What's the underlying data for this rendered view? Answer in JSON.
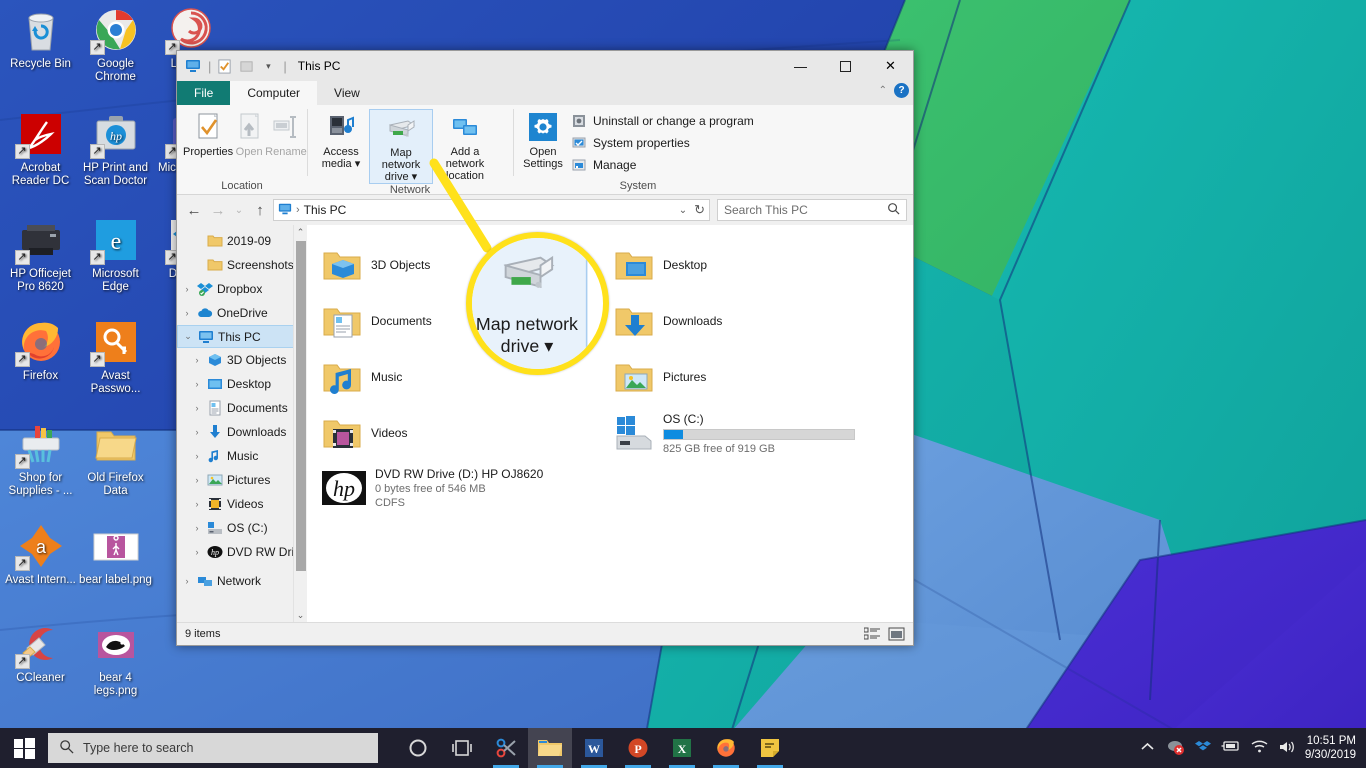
{
  "desktop": {
    "icons": [
      {
        "label": "Recycle Bin",
        "icon": "recycle-bin-icon",
        "shortcut": false
      },
      {
        "label": "Google Chrome",
        "icon": "chrome-icon",
        "shortcut": true
      },
      {
        "label": "Lollipop",
        "icon": "lollipop-icon",
        "shortcut": true
      },
      {
        "label": "Acrobat Reader DC",
        "icon": "acrobat-icon",
        "shortcut": true
      },
      {
        "label": "HP Print and Scan Doctor",
        "icon": "hp-briefcase-icon",
        "shortcut": true
      },
      {
        "label": "Microsoft T...",
        "icon": "teams-icon",
        "shortcut": true
      },
      {
        "label": "HP Officejet Pro 8620",
        "icon": "printer-icon",
        "shortcut": true
      },
      {
        "label": "Microsoft Edge",
        "icon": "edge-icon",
        "shortcut": true
      },
      {
        "label": "Dropbox",
        "icon": "dropbox-icon",
        "shortcut": true
      },
      {
        "label": "Firefox",
        "icon": "firefox-icon",
        "shortcut": true
      },
      {
        "label": "Avast Passwo...",
        "icon": "avast-password-key-icon",
        "shortcut": true
      },
      {
        "label": "Shop for Supplies - ...",
        "icon": "printer-supplies-icon",
        "shortcut": true
      },
      {
        "label": "Old Firefox Data",
        "icon": "folder-icon",
        "shortcut": false
      },
      {
        "label": "Avast Intern...",
        "icon": "avast-icon",
        "shortcut": true
      },
      {
        "label": "bear label.png",
        "icon": "image-thumbnail-icon",
        "shortcut": false
      },
      {
        "label": "CCleaner",
        "icon": "ccleaner-icon",
        "shortcut": true
      },
      {
        "label": "bear 4 legs.png",
        "icon": "image-thumbnail-icon",
        "shortcut": false
      }
    ]
  },
  "window": {
    "title": "This PC",
    "quick_access": [
      "monitor-icon",
      "properties-icon",
      "new-folder-icon",
      "customize-dropdown-icon"
    ],
    "controls": {
      "minimize": "—",
      "maximize": "☐",
      "close": "✕"
    },
    "help_label": "?",
    "collapse_ribbon_label": "⌃"
  },
  "tabs": [
    {
      "label": "File",
      "kind": "file"
    },
    {
      "label": "Computer",
      "kind": "active"
    },
    {
      "label": "View",
      "kind": "normal"
    }
  ],
  "ribbon": {
    "groups": [
      {
        "title": "Location",
        "buttons": [
          {
            "label": "Properties",
            "icon": "properties-icon",
            "disabled": false
          },
          {
            "label": "Open",
            "icon": "open-icon",
            "disabled": true
          },
          {
            "label": "Rename",
            "icon": "rename-icon",
            "disabled": true
          }
        ]
      },
      {
        "title": "Network",
        "buttons": [
          {
            "label": "Access media ▾",
            "icon": "access-media-icon",
            "disabled": false
          },
          {
            "label": "Map network drive ▾",
            "icon": "map-network-drive-icon",
            "disabled": false,
            "highlighted": true
          },
          {
            "label": "Add a network location",
            "icon": "add-network-location-icon",
            "disabled": false
          }
        ]
      },
      {
        "title": "System",
        "big_button": {
          "label": "Open Settings",
          "icon": "gear-icon"
        },
        "small_items": [
          {
            "label": "Uninstall or change a program",
            "icon": "uninstall-program-icon"
          },
          {
            "label": "System properties",
            "icon": "system-properties-icon"
          },
          {
            "label": "Manage",
            "icon": "manage-icon"
          }
        ]
      }
    ]
  },
  "address_bar": {
    "back_label": "←",
    "forward_label": "→",
    "recent_label": "⌄",
    "up_label": "↑",
    "path_icon": "this-pc-icon",
    "path_crumb": "This PC",
    "path_separator": "›",
    "dropdown_label": "⌄",
    "refresh_label": "↻",
    "search_placeholder": "Search This PC",
    "search_value": "",
    "search_icon": "magnifier-icon"
  },
  "nav_pane": {
    "items": [
      {
        "label": "2019-09",
        "icon": "folder-icon",
        "expander": "",
        "indent": 1,
        "selected": false
      },
      {
        "label": "Screenshots",
        "icon": "folder-icon",
        "expander": "",
        "indent": 1,
        "selected": false
      },
      {
        "label": "Dropbox",
        "icon": "dropbox-icon",
        "expander": "›",
        "indent": 0,
        "selected": false
      },
      {
        "label": "OneDrive",
        "icon": "onedrive-icon",
        "expander": "›",
        "indent": 0,
        "selected": false
      },
      {
        "label": "This PC",
        "icon": "this-pc-icon",
        "expander": "⌄",
        "indent": 0,
        "selected": true
      },
      {
        "label": "3D Objects",
        "icon": "3d-objects-icon",
        "expander": "›",
        "indent": 1,
        "selected": false
      },
      {
        "label": "Desktop",
        "icon": "desktop-icon",
        "expander": "›",
        "indent": 1,
        "selected": false
      },
      {
        "label": "Documents",
        "icon": "documents-icon",
        "expander": "›",
        "indent": 1,
        "selected": false
      },
      {
        "label": "Downloads",
        "icon": "downloads-icon",
        "expander": "›",
        "indent": 1,
        "selected": false
      },
      {
        "label": "Music",
        "icon": "music-icon",
        "expander": "›",
        "indent": 1,
        "selected": false
      },
      {
        "label": "Pictures",
        "icon": "pictures-icon",
        "expander": "›",
        "indent": 1,
        "selected": false
      },
      {
        "label": "Videos",
        "icon": "videos-icon",
        "expander": "›",
        "indent": 1,
        "selected": false
      },
      {
        "label": "OS (C:)",
        "icon": "drive-icon",
        "expander": "›",
        "indent": 1,
        "selected": false
      },
      {
        "label": "DVD RW Drive (D",
        "icon": "hp-disc-icon",
        "expander": "›",
        "indent": 1,
        "selected": false
      },
      {
        "label": "Network",
        "icon": "network-icon",
        "expander": "›",
        "indent": 0,
        "selected": false
      }
    ]
  },
  "content": {
    "folders": [
      {
        "label": "3D Objects",
        "icon": "3d-objects-folder-icon"
      },
      {
        "label": "Desktop",
        "icon": "desktop-folder-icon"
      },
      {
        "label": "Documents",
        "icon": "documents-folder-icon"
      },
      {
        "label": "Downloads",
        "icon": "downloads-folder-icon"
      },
      {
        "label": "Music",
        "icon": "music-folder-icon"
      },
      {
        "label": "Pictures",
        "icon": "pictures-folder-icon"
      },
      {
        "label": "Videos",
        "icon": "videos-folder-icon"
      }
    ],
    "drives": [
      {
        "name": "OS (C:)",
        "sub": "825 GB free of 919 GB",
        "used_percent": 10,
        "icon": "windows-drive-icon"
      }
    ],
    "optical": {
      "name": "DVD RW Drive (D:) HP OJ8620",
      "sub": "0 bytes free of 546 MB",
      "filesystem": "CDFS",
      "icon": "hp-disc-icon"
    }
  },
  "status_bar": {
    "item_count": "9 items",
    "view_buttons": [
      {
        "icon": "details-view-icon"
      },
      {
        "icon": "large-icons-view-icon"
      }
    ]
  },
  "callout": {
    "magnified_label_line1": "Map network",
    "magnified_label_line2": "drive ▾",
    "icon": "map-network-drive-icon",
    "ring_color": "#ffe11b"
  },
  "taskbar": {
    "start_icon": "windows-start-icon",
    "search_placeholder": "Type here to search",
    "search_icon": "magnifier-icon",
    "buttons": [
      {
        "icon": "cortana-icon",
        "name": "cortana",
        "running": false
      },
      {
        "icon": "task-view-icon",
        "name": "task-view",
        "running": false
      },
      {
        "icon": "snip-sketch-icon",
        "name": "snip-and-sketch",
        "running": true
      },
      {
        "icon": "file-explorer-icon",
        "name": "file-explorer",
        "running": true,
        "active": true
      },
      {
        "icon": "word-icon",
        "name": "microsoft-word",
        "running": true
      },
      {
        "icon": "powerpoint-icon",
        "name": "microsoft-powerpoint",
        "running": true
      },
      {
        "icon": "excel-icon",
        "name": "microsoft-excel",
        "running": true
      },
      {
        "icon": "firefox-icon",
        "name": "firefox",
        "running": true
      },
      {
        "icon": "sticky-notes-icon",
        "name": "sticky-notes",
        "running": true
      }
    ],
    "tray": [
      {
        "icon": "show-hidden-icons-chevron"
      },
      {
        "icon": "avast-tray-icon"
      },
      {
        "icon": "dropbox-tray-icon"
      },
      {
        "icon": "battery-icon"
      },
      {
        "icon": "wifi-icon"
      },
      {
        "icon": "volume-icon"
      }
    ],
    "clock_time": "10:51 PM",
    "clock_date": "9/30/2019"
  },
  "colors": {
    "file_tab": "#117b73",
    "accent_blue": "#0f8ce0",
    "callout_yellow": "#ffe11b",
    "selection_blue": "#cce3f5",
    "taskbar": "#1f1f2e"
  }
}
